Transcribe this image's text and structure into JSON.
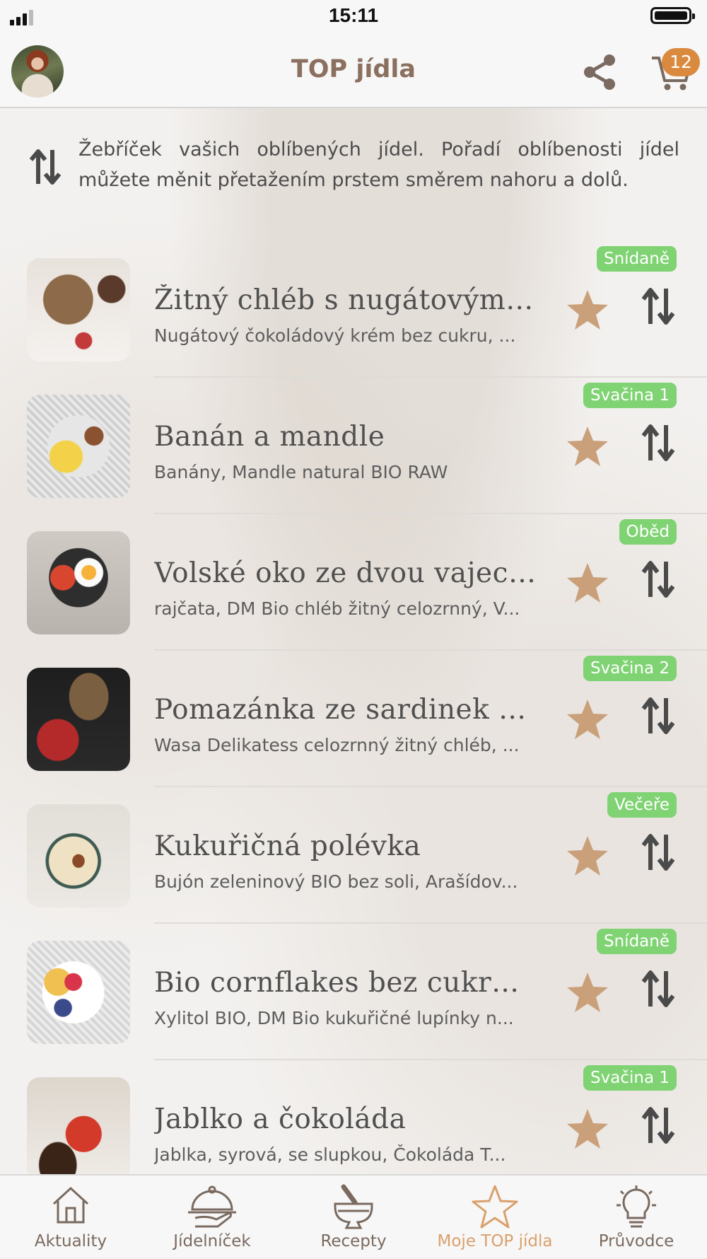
{
  "status_bar": {
    "time": "15:11"
  },
  "header": {
    "title": "TOP jídla",
    "cart_count": "12"
  },
  "info": {
    "text": "Žebříček vašich oblíbených jídel. Pořadí oblíbenosti jídel můžete měnit přetažením prstem směrem nahoru a dolů."
  },
  "colors": {
    "accent": "#c9a07a",
    "tag_green": "#7fd373",
    "title": "#8b6f5f",
    "badge": "#d98a3f"
  },
  "items": [
    {
      "tag": "Snídaně",
      "name": "Žitný chléb s nugátovým ...",
      "desc": "Nugátový čokoládový krém bez cukru, ..."
    },
    {
      "tag": "Svačina 1",
      "name": "Banán a mandle",
      "desc": "Banány, Mandle natural BIO RAW"
    },
    {
      "tag": "Oběd",
      "name": "Volské oko ze dvou vajec,...",
      "desc": "rajčata, DM Bio chléb žitný celozrnný, V..."
    },
    {
      "tag": "Svačina 2",
      "name": "Pomazánka ze sardinek v...",
      "desc": "Wasa Delikatess celozrnný žitný chléb, ..."
    },
    {
      "tag": "Večeře",
      "name": "Kukuřičná polévka",
      "desc": "Bujón zeleninový BIO bez soli, Arašídov..."
    },
    {
      "tag": "Snídaně",
      "name": "Bio cornflakes bez cukru,...",
      "desc": "Xylitol BIO, DM Bio kukuřičné lupínky n..."
    },
    {
      "tag": "Svačina 1",
      "name": "Jablko a čokoláda",
      "desc": "Jablka, syrová, se slupkou, Čokoláda T..."
    }
  ],
  "tabs": [
    {
      "label": "Aktuality",
      "icon": "house-icon"
    },
    {
      "label": "Jídelníček",
      "icon": "cloche-icon"
    },
    {
      "label": "Recepty",
      "icon": "mortar-icon"
    },
    {
      "label": "Moje TOP jídla",
      "icon": "star-icon",
      "active": true
    },
    {
      "label": "Průvodce",
      "icon": "lightbulb-icon"
    }
  ]
}
